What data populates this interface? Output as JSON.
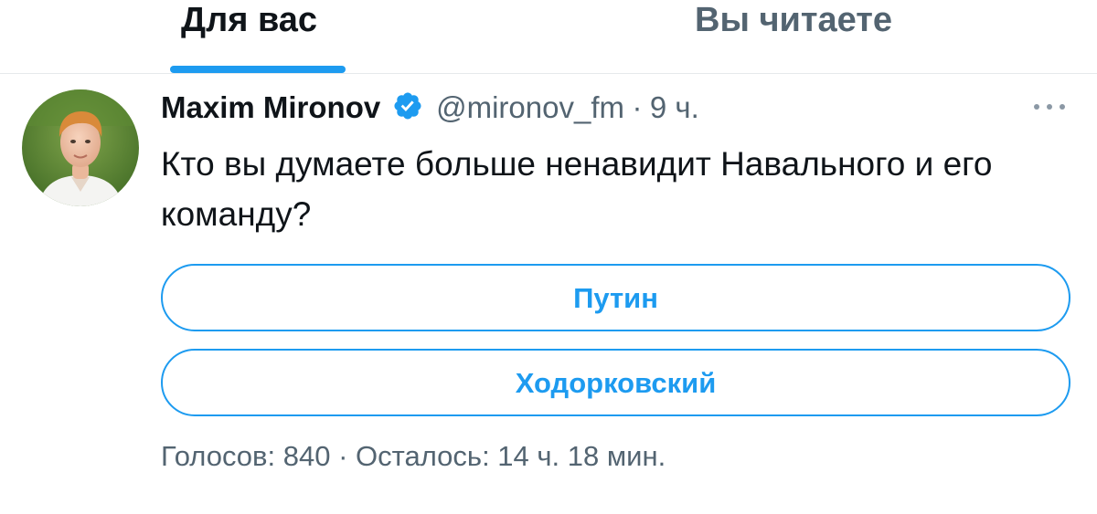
{
  "tabs": [
    {
      "label": "Для вас",
      "active": true
    },
    {
      "label": "Вы читаете",
      "active": false
    }
  ],
  "tweet": {
    "author": {
      "display_name": "Maxim Mironov",
      "verified": true,
      "handle": "@mironov_fm"
    },
    "separator": "·",
    "timestamp": "9 ч.",
    "text": "Кто вы думаете больше ненавидит Навального и его команду?",
    "poll": {
      "options": [
        {
          "label": "Путин"
        },
        {
          "label": "Ходорковский"
        }
      ],
      "votes_text": "Голосов: 840",
      "separator": "·",
      "remaining_text": "Осталось: 14 ч. 18 мин."
    }
  },
  "colors": {
    "accent": "#1d9bf0",
    "secondary_text": "#536471",
    "primary_text": "#0f1419"
  },
  "icons": {
    "verified": "verified-badge-icon",
    "more": "more-horizontal-icon"
  }
}
